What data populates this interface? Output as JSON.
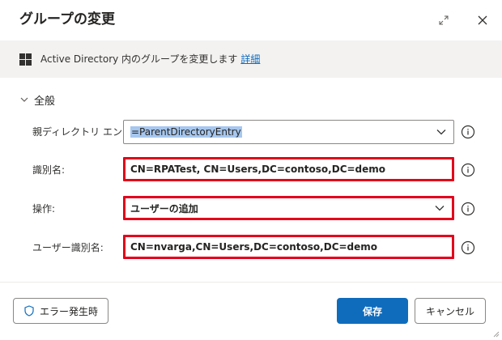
{
  "dialog": {
    "title": "グループの変更",
    "expand_icon": "expand-icon",
    "close_icon": "close-icon"
  },
  "info": {
    "icon": "windows-icon",
    "text": "Active Directory 内のグループを変更します",
    "link": "詳細"
  },
  "section": {
    "label": "全般",
    "icon": "chevron-down-icon"
  },
  "fields": [
    {
      "label": "親ディレクトリ エントリ:",
      "value": "=ParentDirectoryEntry",
      "type": "dropdown",
      "highlighted": false
    },
    {
      "label": "識別名:",
      "value": "CN=RPATest, CN=Users,DC=contoso,DC=demo",
      "type": "text",
      "highlighted": true
    },
    {
      "label": "操作:",
      "value": "ユーザーの追加",
      "type": "dropdown",
      "highlighted": true
    },
    {
      "label": "ユーザー識別名:",
      "value": "CN=nvarga,CN=Users,DC=contoso,DC=demo",
      "type": "text",
      "highlighted": true
    }
  ],
  "footer": {
    "on_error_label": "エラー発生時",
    "save_label": "保存",
    "cancel_label": "キャンセル"
  },
  "colors": {
    "accent": "#0f6cbd",
    "highlight_border": "#e3001b",
    "selection": "#a6c7ee",
    "info_band": "#f3f2f1"
  }
}
